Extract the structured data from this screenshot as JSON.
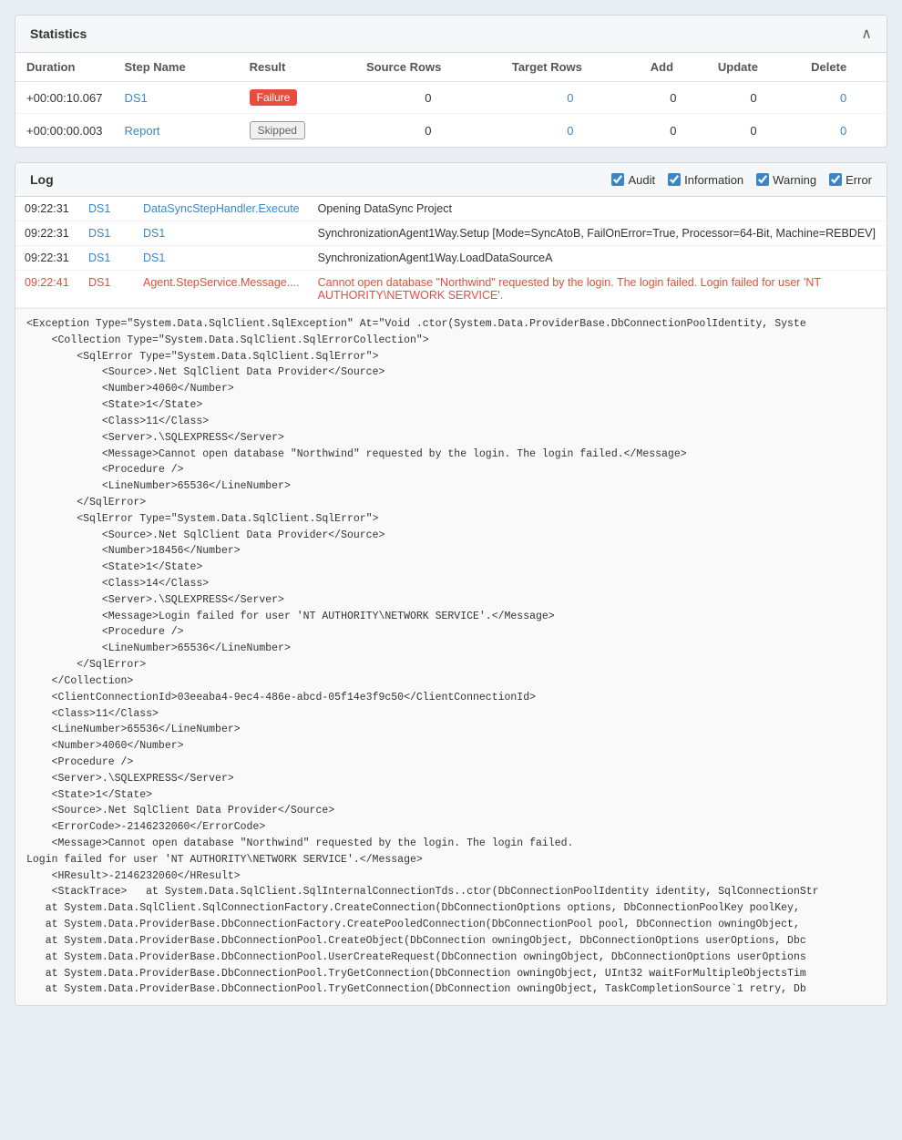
{
  "statistics": {
    "title": "Statistics",
    "collapse_icon": "∧",
    "columns": [
      "Duration",
      "Step Name",
      "Result",
      "Source Rows",
      "Target Rows",
      "Add",
      "Update",
      "Delete"
    ],
    "rows": [
      {
        "duration": "+00:00:10.067",
        "step_name": "DS1",
        "result": "Failure",
        "result_type": "failure",
        "source_rows": "0",
        "target_rows": "0",
        "add": "0",
        "update": "0",
        "delete": "0"
      },
      {
        "duration": "+00:00:00.003",
        "step_name": "Report",
        "result": "Skipped",
        "result_type": "skipped",
        "source_rows": "0",
        "target_rows": "0",
        "add": "0",
        "update": "0",
        "delete": "0"
      }
    ]
  },
  "log": {
    "title": "Log",
    "filters": [
      {
        "label": "Audit",
        "checked": true
      },
      {
        "label": "Information",
        "checked": true
      },
      {
        "label": "Warning",
        "checked": true
      },
      {
        "label": "Error",
        "checked": true
      }
    ],
    "entries": [
      {
        "time": "09:22:31",
        "step": "DS1",
        "handler": "DataSyncStepHandler.Execute",
        "message": "Opening DataSync Project",
        "type": "normal"
      },
      {
        "time": "09:22:31",
        "step": "DS1",
        "handler": "DS1",
        "message": "SynchronizationAgent1Way.Setup [Mode=SyncAtoB, FailOnError=True, Processor=64-Bit, Machine=REBDEV]",
        "type": "normal"
      },
      {
        "time": "09:22:31",
        "step": "DS1",
        "handler": "DS1",
        "message": "SynchronizationAgent1Way.LoadDataSourceA",
        "type": "normal"
      },
      {
        "time": "09:22:41",
        "step": "DS1",
        "handler": "Agent.StepService.Message....",
        "message": "Cannot open database \"Northwind\" requested by the login. The login failed. Login failed for user 'NT AUTHORITY\\NETWORK SERVICE'.",
        "type": "error"
      }
    ],
    "exception_text": "<Exception Type=\"System.Data.SqlClient.SqlException\" At=\"Void .ctor(System.Data.ProviderBase.DbConnectionPoolIdentity, Syste\n    <Collection Type=\"System.Data.SqlClient.SqlErrorCollection\">\n        <SqlError Type=\"System.Data.SqlClient.SqlError\">\n            <Source>.Net SqlClient Data Provider</Source>\n            <Number>4060</Number>\n            <State>1</State>\n            <Class>11</Class>\n            <Server>.\\SQLEXPRESS</Server>\n            <Message>Cannot open database \"Northwind\" requested by the login. The login failed.</Message>\n            <Procedure />\n            <LineNumber>65536</LineNumber>\n        </SqlError>\n        <SqlError Type=\"System.Data.SqlClient.SqlError\">\n            <Source>.Net SqlClient Data Provider</Source>\n            <Number>18456</Number>\n            <State>1</State>\n            <Class>14</Class>\n            <Server>.\\SQLEXPRESS</Server>\n            <Message>Login failed for user 'NT AUTHORITY\\NETWORK SERVICE'.</Message>\n            <Procedure />\n            <LineNumber>65536</LineNumber>\n        </SqlError>\n    </Collection>\n    <ClientConnectionId>03eeaba4-9ec4-486e-abcd-05f14e3f9c50</ClientConnectionId>\n    <Class>11</Class>\n    <LineNumber>65536</LineNumber>\n    <Number>4060</Number>\n    <Procedure />\n    <Server>.\\SQLEXPRESS</Server>\n    <State>1</State>\n    <Source>.Net SqlClient Data Provider</Source>\n    <ErrorCode>-2146232060</ErrorCode>\n    <Message>Cannot open database \"Northwind\" requested by the login. The login failed.\nLogin failed for user 'NT AUTHORITY\\NETWORK SERVICE'.</Message>\n    <HResult>-2146232060</HResult>\n    <StackTrace>   at System.Data.SqlClient.SqlInternalConnectionTds..ctor(DbConnectionPoolIdentity identity, SqlConnectionStr\n   at System.Data.SqlClient.SqlConnectionFactory.CreateConnection(DbConnectionOptions options, DbConnectionPoolKey poolKey,\n   at System.Data.ProviderBase.DbConnectionFactory.CreatePooledConnection(DbConnectionPool pool, DbConnection owningObject,\n   at System.Data.ProviderBase.DbConnectionPool.CreateObject(DbConnection owningObject, DbConnectionOptions userOptions, Dbc\n   at System.Data.ProviderBase.DbConnectionPool.UserCreateRequest(DbConnection owningObject, DbConnectionOptions userOptions\n   at System.Data.ProviderBase.DbConnectionPool.TryGetConnection(DbConnection owningObject, UInt32 waitForMultipleObjectsTim\n   at System.Data.ProviderBase.DbConnectionPool.TryGetConnection(DbConnection owningObject, TaskCompletionSource`1 retry, Db"
  }
}
